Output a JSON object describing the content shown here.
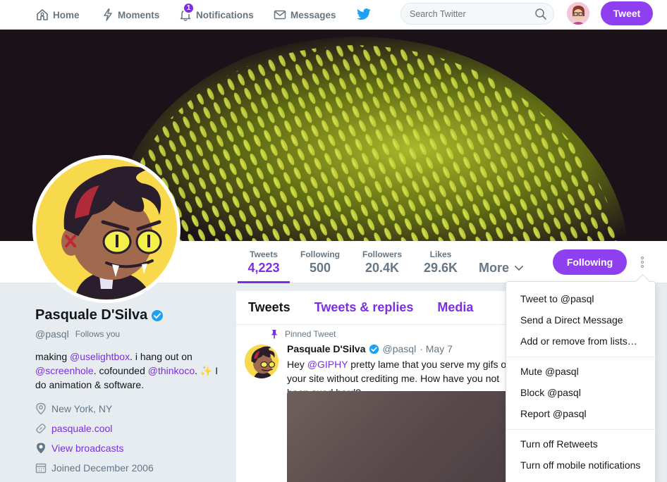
{
  "topnav": {
    "home": "Home",
    "moments": "Moments",
    "notifications": "Notifications",
    "notifications_badge": "1",
    "messages": "Messages",
    "search_placeholder": "Search Twitter",
    "tweet_button": "Tweet"
  },
  "profile_nav": {
    "stats": [
      {
        "label": "Tweets",
        "value": "4,223"
      },
      {
        "label": "Following",
        "value": "500"
      },
      {
        "label": "Followers",
        "value": "20.4K"
      },
      {
        "label": "Likes",
        "value": "29.6K"
      }
    ],
    "more": "More",
    "follow_button": "Following"
  },
  "profile": {
    "name": "Pasquale D'Silva",
    "handle": "@pasql",
    "follows_you": "Follows you",
    "bio": {
      "p1": "making ",
      "l1": "@uselightbox",
      "p2": ". i hang out on ",
      "l2": "@screenhole",
      "p3": ". cofounded ",
      "l3": "@thinkoco",
      "p4": ". ",
      "emoji": "✨",
      "p5": " I do animation & software."
    },
    "location": "New York, NY",
    "website": "pasquale.cool",
    "broadcasts": "View broadcasts",
    "joined": "Joined December 2006"
  },
  "timeline": {
    "tabs": [
      "Tweets",
      "Tweets & replies",
      "Media"
    ],
    "pinned_label": "Pinned Tweet",
    "tweet": {
      "name": "Pasquale D'Silva",
      "handle": "@pasql",
      "date": "· May 7",
      "text_1": "Hey ",
      "mention": "@GIPHY",
      "text_2": " pretty lame that you serve my gifs on your site without crediting me. How have you not been sued hard?"
    }
  },
  "dropdown": {
    "items": [
      "Tweet to @pasql",
      "Send a Direct Message",
      "Add or remove from lists…",
      "Mute @pasql",
      "Block @pasql",
      "Report @pasql",
      "Turn off Retweets",
      "Turn off mobile notifications"
    ]
  },
  "colors": {
    "accent": "#7b2fe0",
    "button": "#8e3ff0",
    "twitter_blue": "#1da1f2"
  }
}
